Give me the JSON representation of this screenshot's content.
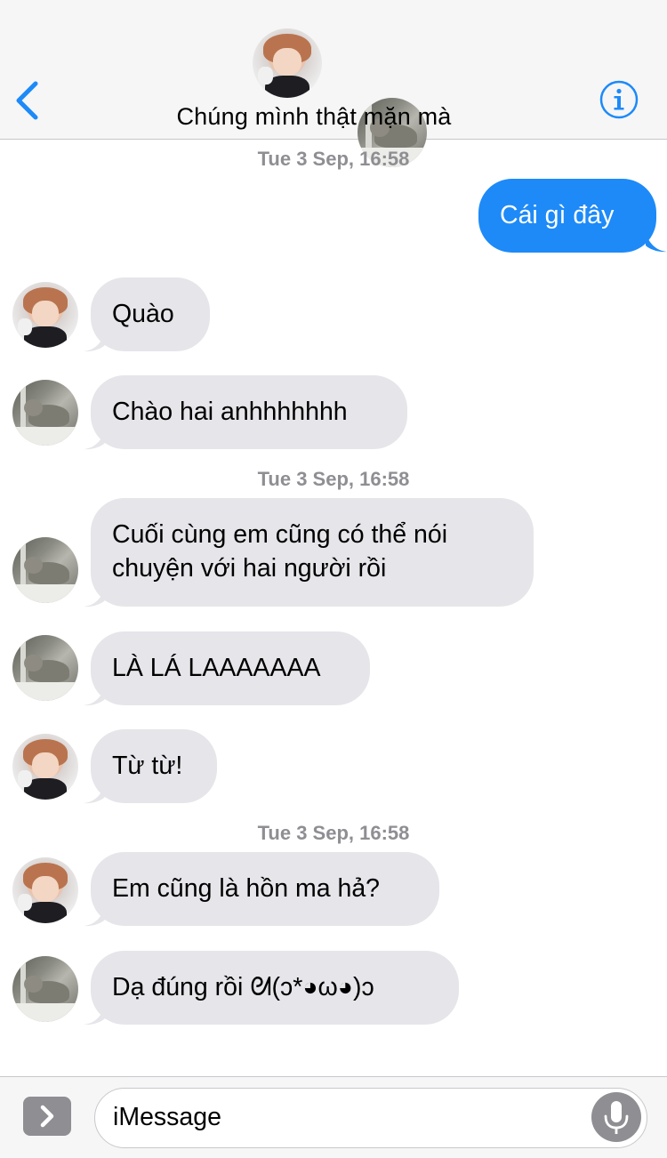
{
  "header": {
    "title": "Chúng mình thật mặn mà",
    "back_icon": "chevron-left-icon",
    "info_icon": "info-circle-icon",
    "accent_color": "#1d8af8"
  },
  "messages": [
    {
      "type": "timestamp",
      "text": "Tue 3 Sep, 16:58"
    },
    {
      "type": "outgoing",
      "text": "Cái gì đây"
    },
    {
      "type": "incoming",
      "sender_avatar": "person",
      "text": "Quào"
    },
    {
      "type": "incoming",
      "sender_avatar": "cat",
      "text": "Chào hai anhhhhhhh"
    },
    {
      "type": "timestamp",
      "text": "Tue 3 Sep, 16:58"
    },
    {
      "type": "incoming",
      "sender_avatar": "cat",
      "lines": [
        "Cuối cùng em cũng có thể nói",
        "chuyện với hai người rồi"
      ]
    },
    {
      "type": "incoming",
      "sender_avatar": "cat",
      "text": "LÀ LÁ LAAAAAAA"
    },
    {
      "type": "incoming",
      "sender_avatar": "person",
      "text": "Từ từ!"
    },
    {
      "type": "timestamp",
      "text": "Tue 3 Sep, 16:58"
    },
    {
      "type": "incoming",
      "sender_avatar": "person",
      "text": "Em cũng là hồn ma hả?"
    },
    {
      "type": "incoming",
      "sender_avatar": "cat",
      "text": "Dạ đúng rồi ᘛ(ↄ*◕ω◕)ↄ"
    }
  ],
  "input": {
    "placeholder": "iMessage",
    "apps_icon": "chevron-right-icon",
    "mic_icon": "microphone-icon"
  },
  "colors": {
    "incoming_bubble": "#e5e5ea",
    "outgoing_bubble": "#1d8af8",
    "timestamp": "#8e8e93"
  }
}
